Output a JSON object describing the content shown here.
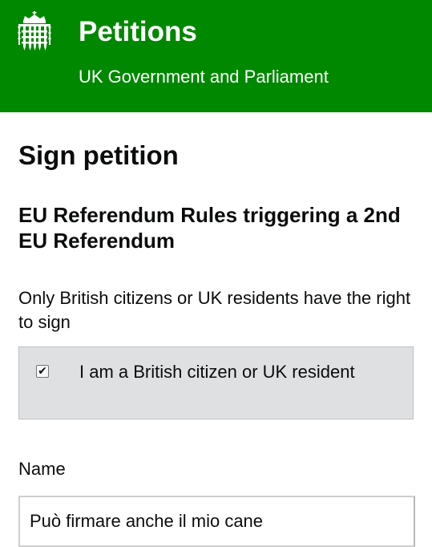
{
  "header": {
    "title": "Petitions",
    "subtitle": "UK Government and Parliament",
    "logo_icon": "portcullis-icon",
    "background_color": "#008800"
  },
  "page": {
    "title": "Sign petition",
    "petition_title": "EU Referendum Rules triggering a 2nd EU Referendum",
    "eligibility_text": "Only British citizens or UK residents have the right to sign"
  },
  "form": {
    "citizen_checkbox": {
      "label": "I am a British citizen or UK resident",
      "checked": true
    },
    "name_field": {
      "label": "Name",
      "value": "Può firmare anche il mio cane"
    }
  }
}
